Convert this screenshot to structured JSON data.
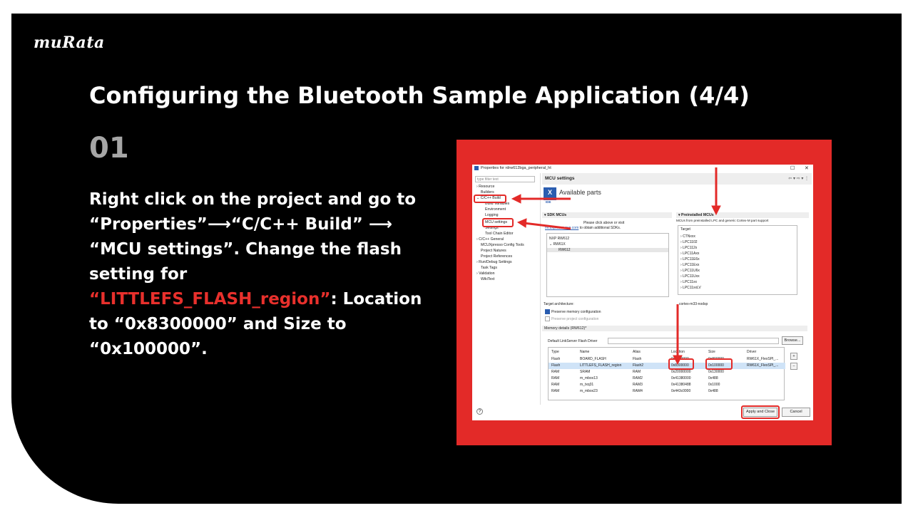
{
  "brand": "muRata",
  "title": "Configuring the Bluetooth Sample Application (4/4)",
  "step": "01",
  "instructions": {
    "l1": "Right click on the project and go to",
    "l2a": "“Properties”",
    "l2b": "“C/C++ Build”",
    "l3": "“MCU settings”. Change the flash",
    "l4": "setting for",
    "l5_hl": "“LITTLEFS_FLASH_region”",
    "l5b": ": Location",
    "l6": "to “0x8300000” and Size to",
    "l7": "“0x100000”."
  },
  "dialog": {
    "title": "Properties for rdrw612bga_peripheral_ht",
    "filter_placeholder": "type filter text",
    "tree": [
      "Resource",
      "Builders",
      "C/C++ Build",
      "Build Variables",
      "Environment",
      "Logging",
      "MCU settings",
      "Settings",
      "Tool Chain Editor",
      "C/C++ General",
      "MCUXpresso Config Tools",
      "Project Natures",
      "Project References",
      "Run/Debug Settings",
      "Task Tags",
      "Validation",
      "WikiText"
    ],
    "panel_title": "MCU settings",
    "available_parts": "Available parts",
    "ide_label": "IDE",
    "sdk_mcus": "SDK MCUs",
    "sdk_hint": "Please click above or visit",
    "sdk_link": "mcuxpresso.nxp.com",
    "sdk_hint2": "to obtain additional SDKs.",
    "sdk_items": [
      "NXP RW612",
      "RW61X",
      "RW612"
    ],
    "preinstalled": "Preinstalled MCUs",
    "preinstalled_hint": "MCUs from preinstalled LPC and generic Cortex-M part support",
    "target_label": "Target",
    "targets": [
      "CTNxxx",
      "LPC1102",
      "LPC112x",
      "LPC11Axx",
      "LPC11E6x",
      "LPC11Exx",
      "LPC11U6x",
      "LPC11Uxx",
      "LPC11xx",
      "LPC11xxLV"
    ],
    "target_arch": "Target architecture:",
    "target_arch_val": "cortex-m33-nodsp",
    "preserve_mem": "Preserve memory configuration",
    "preserve_proj": "Preserve project configuration",
    "memory_details": "Memory details (RW612)*",
    "flash_driver": "Default LinkServer Flash Driver",
    "browse": "Browse...",
    "mem_headers": [
      "Type",
      "Name",
      "Alias",
      "Location",
      "Size",
      "Driver"
    ],
    "mem_rows": [
      [
        "Flash",
        "BOARD_FLASH",
        "Flash",
        "0x8000000",
        "0x800000",
        "RW61X_FlexSPI_..."
      ],
      [
        "Flash",
        "LITTLEFS_FLASH_region",
        "Flash2",
        "0x8300000",
        "0x100000",
        "RW61X_FlexSPI_..."
      ],
      [
        "RAM",
        "SRAM",
        "RAM",
        "0x20000000",
        "0x130000",
        ""
      ],
      [
        "RAM",
        "m_mbox13",
        "RAM2",
        "0x41380000",
        "0x488",
        ""
      ],
      [
        "RAM",
        "m_txq31",
        "RAM3",
        "0x41380488",
        "0x1000",
        ""
      ],
      [
        "RAM",
        "m_mbox23",
        "RAM4",
        "0x443c0000",
        "0x488",
        ""
      ]
    ],
    "apply_close": "Apply and Close",
    "cancel": "Cancel",
    "help": "?"
  },
  "colors": {
    "accent": "#e32a28",
    "background": "#000000",
    "muted": "#a6a6a6"
  }
}
